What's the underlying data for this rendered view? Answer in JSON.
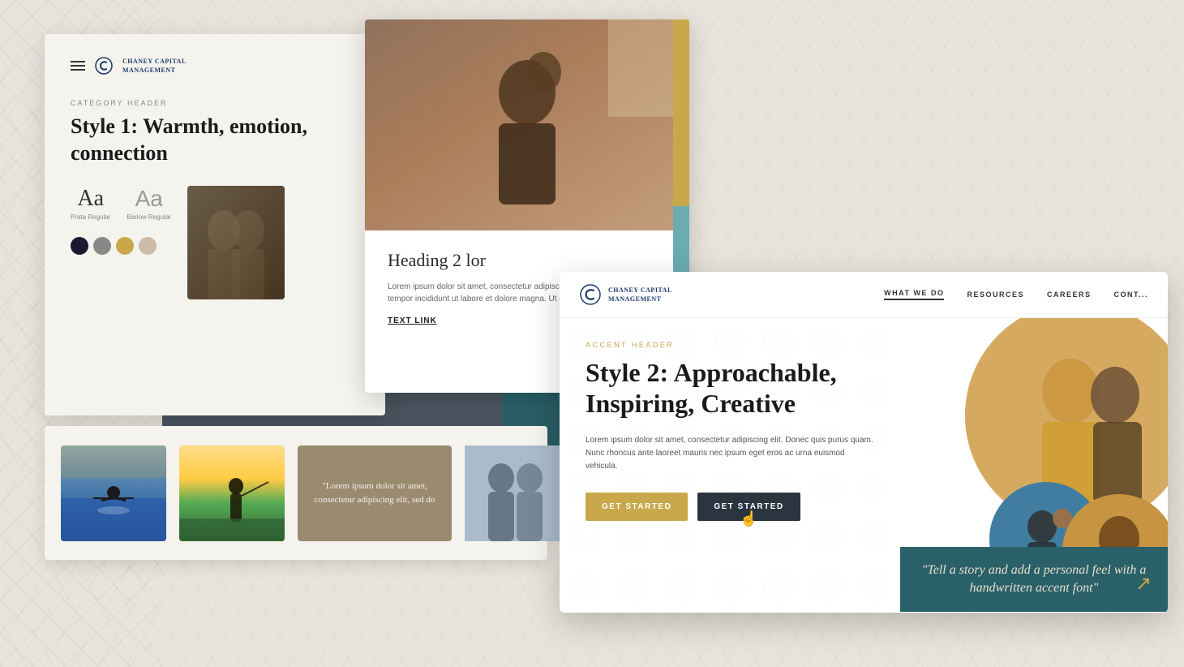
{
  "brand": {
    "name_line1": "Chaney Capital",
    "name_line2": "Management",
    "logo_symbol": "C"
  },
  "card_style_guide": {
    "nav": {
      "hamburger_label": "menu",
      "logo_name_line1": "Chaney Capital",
      "logo_name_line2": "Management"
    },
    "category_label": "Category Header",
    "heading": "Style 1: Warmth, emotion, connection",
    "font1_sample": "Aa",
    "font1_name": "Prata Regular",
    "font2_sample": "Aa",
    "font2_name": "Barlow Regular",
    "colors": [
      "#1a1a2e",
      "#888888",
      "#c8a84b",
      "#ccbba8"
    ]
  },
  "card_photo_content": {
    "heading": "Heading 2 lor",
    "body": "Lorem ipsum dolor sit amet, consectetur adipiscing elit, sed do eiusmod tempor incididunt ut labore et dolore magna. Ut enim ad minim veniam, quis.",
    "text_link": "TEXT LINK"
  },
  "card_thumbnails": {
    "quote_text": "\"Lorem ipsum dolor sit amet, consectetur adipiscing elit, sed do"
  },
  "card_website": {
    "nav": {
      "logo_line1": "Chaney Capital",
      "logo_line2": "Management",
      "items": [
        "What We Do",
        "Resources",
        "Careers",
        "Cont..."
      ]
    },
    "accent_header": "Accent Header",
    "heading": "Style 2: Approachable, Inspiring, Creative",
    "body": "Lorem ipsum dolor sit amet, consectetur adipiscing elit. Donec quis purus quam. Nunc rhoncus ante laoreet mauris nec ipsum eget eros ac urna euismod vehicula.",
    "btn_primary": "GET STARTED",
    "btn_secondary": "GET STARTED",
    "handwritten": "\"Tell a story and add a personal feel with a handwritten accent font\""
  }
}
